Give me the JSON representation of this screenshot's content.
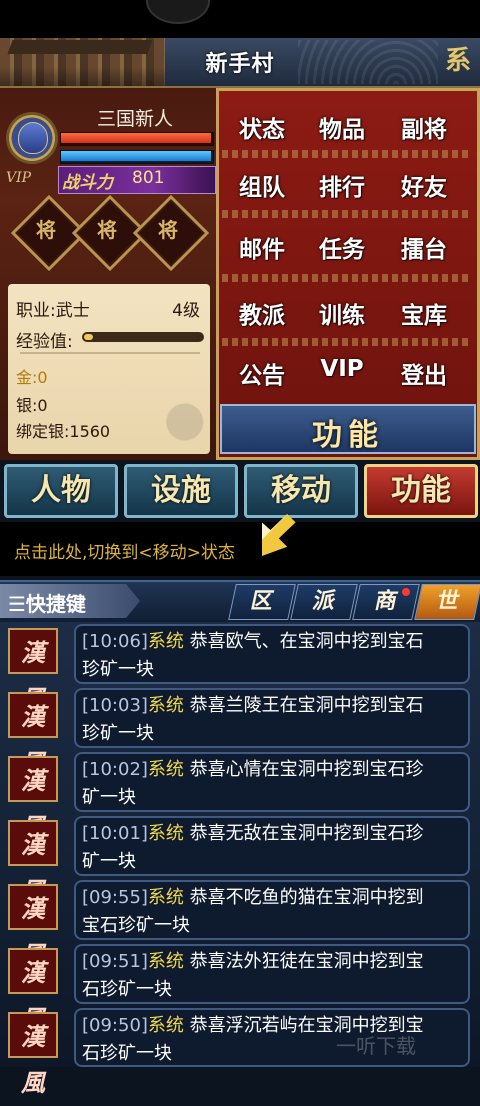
{
  "header": {
    "title": "新手村",
    "brand_glyph": "系"
  },
  "player": {
    "name": "三国新人",
    "vip_label": "VIP",
    "power_label": "战斗力",
    "power_value": "801",
    "hp_fraction": 1.0,
    "mp_fraction": 1.0
  },
  "generals": [
    "将",
    "将",
    "将"
  ],
  "info": {
    "job": "职业:武士",
    "level": "4级",
    "exp_label": "经验值:",
    "exp_fraction": 0.08,
    "gold": "金:0",
    "silver": "银:0",
    "bound_silver": "绑定银:1560"
  },
  "menu": [
    [
      "状态",
      "物品",
      "副将"
    ],
    [
      "组队",
      "排行",
      "好友"
    ],
    [
      "邮件",
      "任务",
      "擂台"
    ],
    [
      "教派",
      "训练",
      "宝库"
    ],
    [
      "公告",
      "VIP",
      "登出"
    ]
  ],
  "function_banner": "功能",
  "main_tabs": [
    "人物",
    "设施",
    "移动",
    "功能"
  ],
  "hint": "点击此处,切换到<移动>状态",
  "shortcut": {
    "label": "☰快捷键"
  },
  "channels": [
    "区",
    "派",
    "商",
    "世"
  ],
  "chat": [
    {
      "icon": "漢風",
      "time": "[10:06]",
      "sys": "系统",
      "line1": " 恭喜欧气、在宝洞中挖到宝石",
      "line2": "珍矿一块"
    },
    {
      "icon": "漢風",
      "time": "[10:03]",
      "sys": "系统",
      "line1": " 恭喜兰陵王在宝洞中挖到宝石",
      "line2": "珍矿一块"
    },
    {
      "icon": "漢風",
      "time": "[10:02]",
      "sys": "系统",
      "line1": " 恭喜心情在宝洞中挖到宝石珍",
      "line2": "矿一块"
    },
    {
      "icon": "漢風",
      "time": "[10:01]",
      "sys": "系统",
      "line1": " 恭喜无敌在宝洞中挖到宝石珍",
      "line2": "矿一块"
    },
    {
      "icon": "漢風",
      "time": "[09:55]",
      "sys": "系统",
      "line1": " 恭喜不吃鱼的猫在宝洞中挖到",
      "line2": "宝石珍矿一块"
    },
    {
      "icon": "漢風",
      "time": "[09:51]",
      "sys": "系统",
      "line1": " 恭喜法外狂徒在宝洞中挖到宝",
      "line2": "石珍矿一块"
    },
    {
      "icon": "漢風",
      "time": "[09:50]",
      "sys": "系统",
      "line1": " 恭喜浮沉若屿在宝洞中挖到宝",
      "line2": "石珍矿一块"
    }
  ],
  "watermark": "一听下载"
}
